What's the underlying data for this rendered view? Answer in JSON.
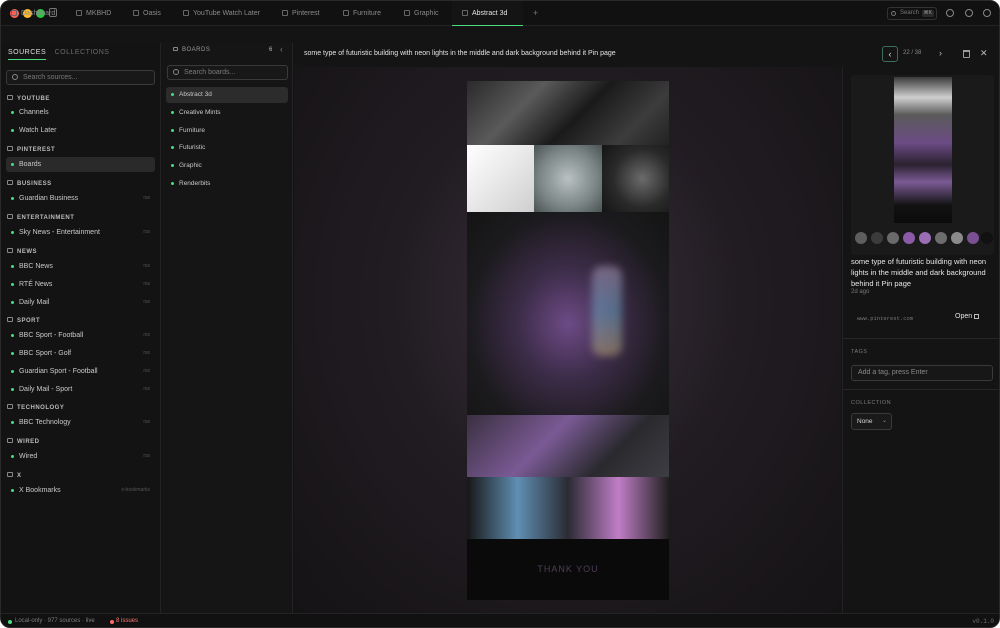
{
  "tabs": [
    {
      "label": "Dashboard",
      "icon": "dashboard-icon"
    },
    {
      "label": "MKBHD",
      "icon": "pin-icon"
    },
    {
      "label": "Oasis",
      "icon": "pin-icon"
    },
    {
      "label": "YouTube Watch Later",
      "icon": "youtube-icon"
    },
    {
      "label": "Pinterest",
      "icon": "pinterest-icon"
    },
    {
      "label": "Furniture",
      "icon": "pin-icon"
    },
    {
      "label": "Graphic",
      "icon": "pin-icon"
    },
    {
      "label": "Abstract 3d",
      "icon": "pin-icon"
    }
  ],
  "topbar": {
    "search_placeholder": "Search",
    "search_shortcut": "⌘K"
  },
  "sources": {
    "tab_sources": "SOURCES",
    "tab_collections": "COLLECTIONS",
    "search_placeholder": "Search sources...",
    "groups": [
      {
        "name": "YOUTUBE",
        "items": [
          {
            "label": "Channels",
            "tag": ""
          },
          {
            "label": "Watch Later",
            "tag": ""
          }
        ]
      },
      {
        "name": "PINTEREST",
        "items": [
          {
            "label": "Boards",
            "tag": ""
          }
        ]
      },
      {
        "name": "BUSINESS",
        "items": [
          {
            "label": "Guardian Business",
            "tag": "rss"
          }
        ]
      },
      {
        "name": "ENTERTAINMENT",
        "items": [
          {
            "label": "Sky News - Entertainment",
            "tag": "rss"
          }
        ]
      },
      {
        "name": "NEWS",
        "items": [
          {
            "label": "BBC News",
            "tag": "rss"
          },
          {
            "label": "RTÉ News",
            "tag": "rss"
          },
          {
            "label": "Daily Mail",
            "tag": "rss"
          }
        ]
      },
      {
        "name": "SPORT",
        "items": [
          {
            "label": "BBC Sport - Football",
            "tag": "rss"
          },
          {
            "label": "BBC Sport - Golf",
            "tag": "rss"
          },
          {
            "label": "Guardian Sport - Football",
            "tag": "rss"
          },
          {
            "label": "Daily Mail - Sport",
            "tag": "rss"
          }
        ]
      },
      {
        "name": "TECHNOLOGY",
        "items": [
          {
            "label": "BBC Technology",
            "tag": "rss"
          }
        ]
      },
      {
        "name": "WIRED",
        "items": [
          {
            "label": "Wired",
            "tag": "rss"
          }
        ]
      },
      {
        "name": "X",
        "items": [
          {
            "label": "X Bookmarks",
            "tag": "x-bookmarks"
          }
        ]
      }
    ]
  },
  "boards": {
    "header": "BOARDS",
    "count": "6",
    "search_placeholder": "Search boards...",
    "items": [
      "Abstract 3d",
      "Creative Mints",
      "Furniture",
      "Futuristic",
      "Graphic",
      "Renderbits"
    ]
  },
  "viewer": {
    "title": "some type of futuristic building with neon lights in the middle and dark background behind it Pin page",
    "position": "22 / 38",
    "image_caption": "THANK YOU"
  },
  "details": {
    "title": "some type of futuristic building with neon lights in the middle and dark background behind it Pin page",
    "age": "2d ago",
    "url": "www.pinterest.com",
    "open_label": "Open",
    "tags_label": "TAGS",
    "tag_placeholder": "Add a tag, press Enter",
    "collection_label": "COLLECTION",
    "collection_value": "None",
    "swatches": [
      "#5e5e5e",
      "#3b3b3b",
      "#6a6a6a",
      "#8c5aa6",
      "#9a6db5",
      "#6d6d6d",
      "#8a8a8a",
      "#7b4f94",
      "#111111"
    ]
  },
  "status": {
    "text": "Local-only · 977 sources · live",
    "issues": "8 issues",
    "version": "v0.1.0"
  },
  "colors": {
    "accent": "#4ade80",
    "issues": "#ff6b6b"
  }
}
